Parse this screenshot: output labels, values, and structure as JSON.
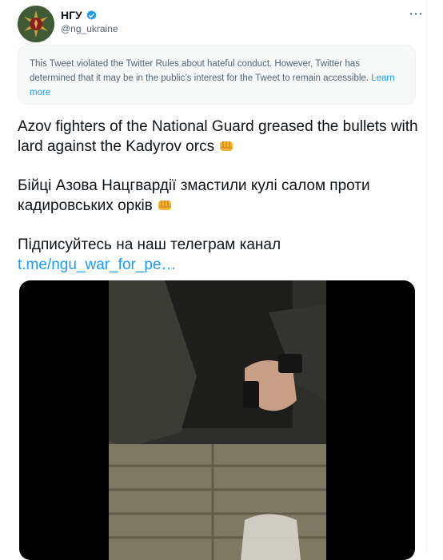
{
  "account": {
    "name": "НГУ",
    "handle": "@ng_ukraine",
    "verified": true
  },
  "icons": {
    "avatar": "national-guard-emblem-icon",
    "verified": "verified-badge-icon",
    "more": "more-options-icon",
    "emoji": "oncoming-fist-emoji-icon"
  },
  "notice": {
    "text": "This Tweet violated the Twitter Rules about hateful conduct. However, Twitter has determined that it may be in the public’s interest for the Tweet to remain accessible.",
    "link_label": "Learn more"
  },
  "tweet": {
    "line1": "Azov fighters of the National Guard greased the bullets with lard against the Kadyrov orcs",
    "line2": "Бійці Азова Нацгвардії змастили кулі салом проти кадировських орків",
    "line3": "Підписуйтесь на наш телеграм канал",
    "link": "t.me/ngu_war_for_pe…"
  },
  "colors": {
    "accent": "#1d9bf0",
    "text": "#0f1419",
    "muted": "#536471",
    "notice_bg": "#f7f9f9",
    "media_bg": "#000000"
  }
}
